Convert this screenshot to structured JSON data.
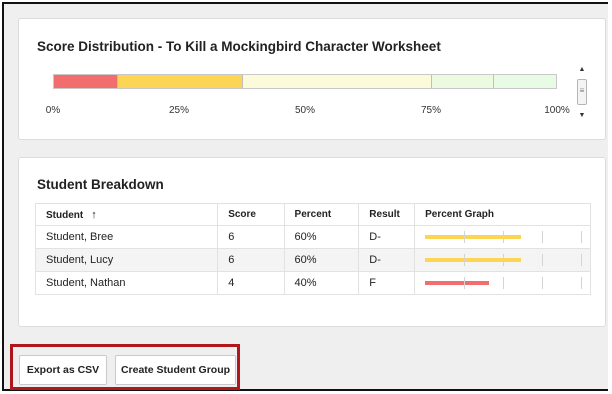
{
  "distribution": {
    "title": "Score Distribution - To Kill a Mockingbird Character Worksheet",
    "segments": [
      {
        "name": "red",
        "share": 0.125,
        "color": "#f26d6d"
      },
      {
        "name": "yellow",
        "share": 0.25,
        "color": "#fbd553"
      },
      {
        "name": "light-yellow",
        "share": 0.375,
        "color": "#fbfbd9"
      },
      {
        "name": "light-green-1",
        "share": 0.125,
        "color": "#ecfbe0"
      },
      {
        "name": "light-green-2",
        "share": 0.125,
        "color": "#e8fbe4"
      }
    ],
    "ticks": [
      "0%",
      "25%",
      "50%",
      "75%",
      "100%"
    ]
  },
  "breakdown": {
    "title": "Student Breakdown",
    "columns": [
      "Student",
      "Score",
      "Percent",
      "Result",
      "Percent Graph"
    ],
    "sort_icon": "arrow-up-icon",
    "rows": [
      {
        "student": "Student, Bree",
        "score": "6",
        "percent": "60%",
        "result": "D-",
        "fraction": 0.6,
        "color": "#fbd553"
      },
      {
        "student": "Student, Lucy",
        "score": "6",
        "percent": "60%",
        "result": "D-",
        "fraction": 0.6,
        "color": "#fbd553"
      },
      {
        "student": "Student, Nathan",
        "score": "4",
        "percent": "40%",
        "result": "F",
        "fraction": 0.4,
        "color": "#f26d6d"
      }
    ]
  },
  "actions": {
    "export_label": "Export as CSV",
    "create_group_label": "Create Student Group"
  }
}
